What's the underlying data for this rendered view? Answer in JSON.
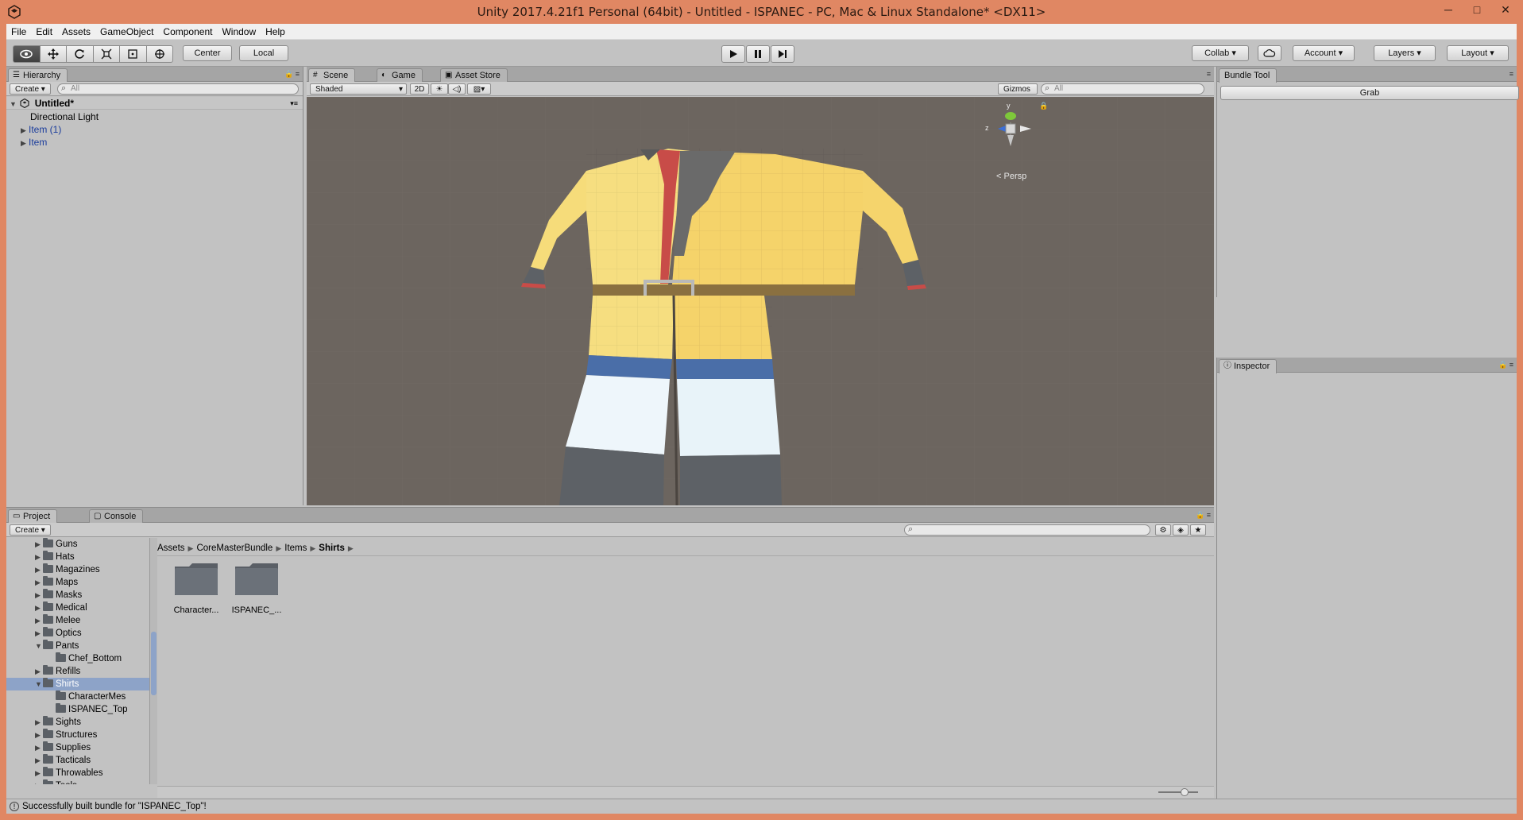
{
  "window": {
    "title": "Unity 2017.4.21f1 Personal (64bit) - Untitled - ISPANEC - PC, Mac & Linux Standalone* <DX11>",
    "minimize": "─",
    "maximize": "□",
    "close": "✕"
  },
  "menu": [
    "File",
    "Edit",
    "Assets",
    "GameObject",
    "Component",
    "Window",
    "Help"
  ],
  "toolbar": {
    "pivot": "Center",
    "space": "Local",
    "collab": "Collab",
    "account": "Account",
    "layers": "Layers",
    "layout": "Layout"
  },
  "hierarchy": {
    "tab": "Hierarchy",
    "create": "Create",
    "search_placeholder": "All",
    "scene": "Untitled*",
    "items": [
      "Directional Light",
      "Item (1)",
      "Item"
    ]
  },
  "scene": {
    "tabs": [
      "Scene",
      "Game",
      "Asset Store"
    ],
    "shading": "Shaded",
    "mode_2d": "2D",
    "gizmos": "Gizmos",
    "search_placeholder": "All",
    "persp": "Persp",
    "axis_y": "y",
    "axis_z": "z"
  },
  "bundle_tool": {
    "tab": "Bundle Tool",
    "grab": "Grab"
  },
  "inspector": {
    "tab": "Inspector"
  },
  "project": {
    "tabs": [
      "Project",
      "Console"
    ],
    "create": "Create",
    "tree": [
      {
        "label": "Guns",
        "level": 1,
        "arrow": "▶"
      },
      {
        "label": "Hats",
        "level": 1,
        "arrow": "▶"
      },
      {
        "label": "Magazines",
        "level": 1,
        "arrow": "▶"
      },
      {
        "label": "Maps",
        "level": 1,
        "arrow": "▶"
      },
      {
        "label": "Masks",
        "level": 1,
        "arrow": "▶"
      },
      {
        "label": "Medical",
        "level": 1,
        "arrow": "▶"
      },
      {
        "label": "Melee",
        "level": 1,
        "arrow": "▶"
      },
      {
        "label": "Optics",
        "level": 1,
        "arrow": "▶"
      },
      {
        "label": "Pants",
        "level": 1,
        "arrow": "▼"
      },
      {
        "label": "Chef_Bottom",
        "level": 2,
        "arrow": ""
      },
      {
        "label": "Refills",
        "level": 1,
        "arrow": "▶"
      },
      {
        "label": "Shirts",
        "level": 1,
        "arrow": "▼",
        "selected": true
      },
      {
        "label": "CharacterMes",
        "level": 2,
        "arrow": ""
      },
      {
        "label": "ISPANEC_Top",
        "level": 2,
        "arrow": ""
      },
      {
        "label": "Sights",
        "level": 1,
        "arrow": "▶"
      },
      {
        "label": "Structures",
        "level": 1,
        "arrow": "▶"
      },
      {
        "label": "Supplies",
        "level": 1,
        "arrow": "▶"
      },
      {
        "label": "Tacticals",
        "level": 1,
        "arrow": "▶"
      },
      {
        "label": "Throwables",
        "level": 1,
        "arrow": "▶"
      },
      {
        "label": "Tools",
        "level": 1,
        "arrow": "▶"
      }
    ],
    "breadcrumb": [
      "Assets",
      "CoreMasterBundle",
      "Items",
      "Shirts"
    ],
    "assets": [
      "Character...",
      "ISPANEC_..."
    ]
  },
  "status": "Successfully built bundle for \"ISPANEC_Top\"!"
}
